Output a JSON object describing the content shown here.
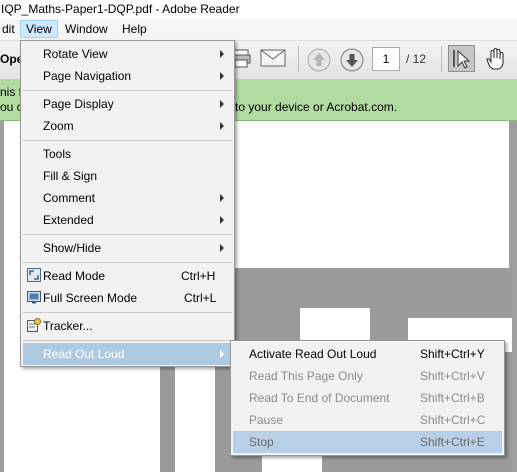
{
  "titlebar": {
    "title": "IQP_Maths-Paper1-DQP.pdf - Adobe Reader"
  },
  "menubar": {
    "items": [
      "dit",
      "View",
      "Window",
      "Help"
    ]
  },
  "toolbar": {
    "left_text": "Ope",
    "page_value": "1",
    "page_total": "/ 12"
  },
  "notification": {
    "line1": "nis f",
    "line2": "ou ca",
    "message": "to your device or Acrobat.com."
  },
  "view_menu": {
    "items": [
      {
        "label": "Rotate View",
        "has_submenu": true
      },
      {
        "label": "Page Navigation",
        "has_submenu": true
      },
      {
        "label": "Page Display",
        "has_submenu": true
      },
      {
        "label": "Zoom",
        "has_submenu": true
      },
      {
        "label": "Tools",
        "has_submenu": false
      },
      {
        "label": "Fill & Sign",
        "has_submenu": false
      },
      {
        "label": "Comment",
        "has_submenu": true
      },
      {
        "label": "Extended",
        "has_submenu": true
      },
      {
        "label": "Show/Hide",
        "has_submenu": true
      },
      {
        "label": "Read Mode",
        "shortcut": "Ctrl+H",
        "icon": "read-mode-icon"
      },
      {
        "label": "Full Screen Mode",
        "shortcut": "Ctrl+L",
        "icon": "full-screen-icon"
      },
      {
        "label": "Tracker...",
        "icon": "tracker-icon"
      },
      {
        "label": "Read Out Loud",
        "has_submenu": true,
        "highlighted": true
      }
    ]
  },
  "read_out_loud_menu": {
    "items": [
      {
        "label": "Activate Read Out Loud",
        "shortcut": "Shift+Ctrl+Y",
        "enabled": true
      },
      {
        "label": "Read This Page Only",
        "shortcut": "Shift+Ctrl+V",
        "enabled": false
      },
      {
        "label": "Read To End of Document",
        "shortcut": "Shift+Ctrl+B",
        "enabled": false
      },
      {
        "label": "Pause",
        "shortcut": "Shift+Ctrl+C",
        "enabled": false
      },
      {
        "label": "Stop",
        "shortcut": "Shift+Ctrl+E",
        "enabled": false,
        "highlighted": true
      }
    ]
  },
  "colors": {
    "menu_highlight": "#aec9e0",
    "notification_bg": "#b2dba2",
    "menubar_active": "#cde8ff"
  }
}
